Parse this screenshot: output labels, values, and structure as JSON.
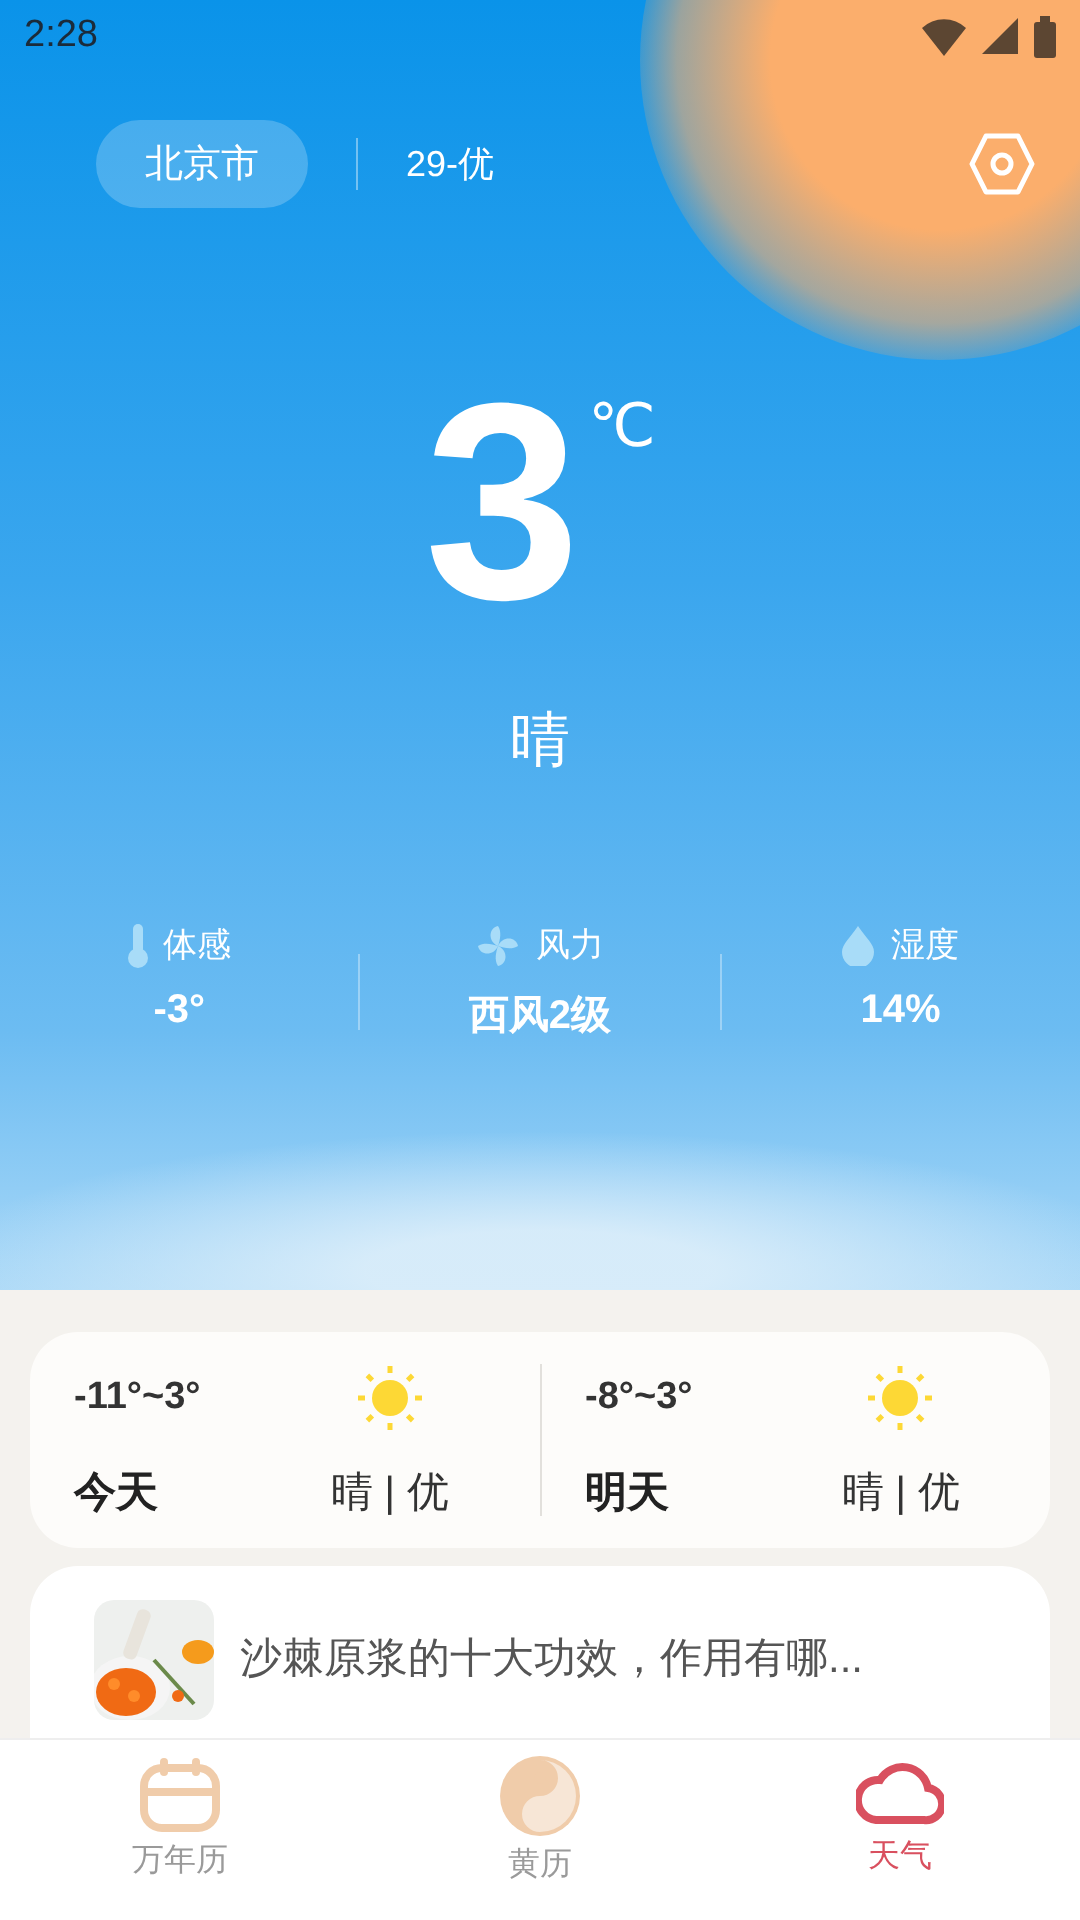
{
  "status_bar": {
    "time": "2:28"
  },
  "header": {
    "city": "北京市",
    "aqi": "29-优"
  },
  "current": {
    "temperature": "3",
    "unit": "℃",
    "condition": "晴"
  },
  "stats": [
    {
      "kind": "thermometer",
      "label": "体感",
      "value": "-3°"
    },
    {
      "kind": "wind",
      "label": "风力",
      "value": "西风2级"
    },
    {
      "kind": "drop",
      "label": "湿度",
      "value": "14%"
    }
  ],
  "forecast": [
    {
      "range": "-11°~3°",
      "day": "今天",
      "summary": "晴 | 优"
    },
    {
      "range": "-8°~3°",
      "day": "明天",
      "summary": "晴 | 优"
    }
  ],
  "news": {
    "kind": "picture",
    "title": "沙棘原浆的十大功效，作用有哪..."
  },
  "tabs": [
    {
      "kind": "calendar",
      "label": "万年历",
      "selected": false
    },
    {
      "kind": "yinyang",
      "label": "黄历",
      "selected": false
    },
    {
      "kind": "cloud",
      "label": "天气",
      "selected": true
    }
  ]
}
